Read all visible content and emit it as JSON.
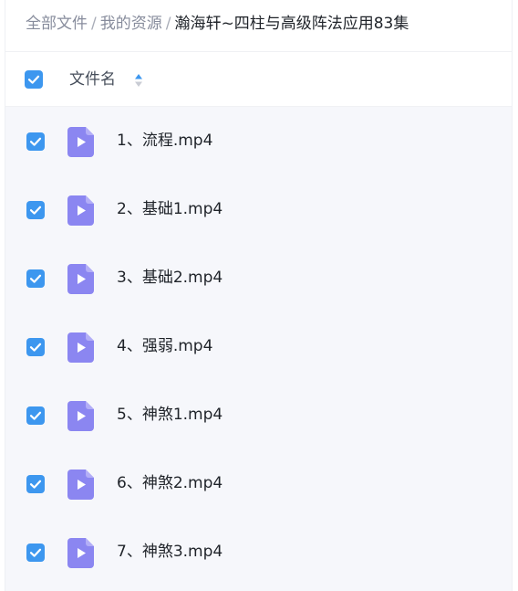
{
  "breadcrumb": {
    "items": [
      "全部文件",
      "我的资源"
    ],
    "separator": "/",
    "current": "瀚海轩~四柱与高级阵法应用83集"
  },
  "header": {
    "select_all_checked": true,
    "column_label": "文件名",
    "sort_icon": "sort-updown-icon"
  },
  "files": [
    {
      "name": "1、流程.mp4",
      "checked": true,
      "icon": "video-file-icon"
    },
    {
      "name": "2、基础1.mp4",
      "checked": true,
      "icon": "video-file-icon"
    },
    {
      "name": "3、基础2.mp4",
      "checked": true,
      "icon": "video-file-icon"
    },
    {
      "name": "4、强弱.mp4",
      "checked": true,
      "icon": "video-file-icon"
    },
    {
      "name": "5、神煞1.mp4",
      "checked": true,
      "icon": "video-file-icon"
    },
    {
      "name": "6、神煞2.mp4",
      "checked": true,
      "icon": "video-file-icon"
    },
    {
      "name": "7、神煞3.mp4",
      "checked": true,
      "icon": "video-file-icon"
    }
  ],
  "colors": {
    "accent": "#3d97ef",
    "file_icon": "#8b86f1",
    "list_background": "#f6f7fb",
    "text": "#1f2329",
    "muted_text": "#878c9c"
  }
}
